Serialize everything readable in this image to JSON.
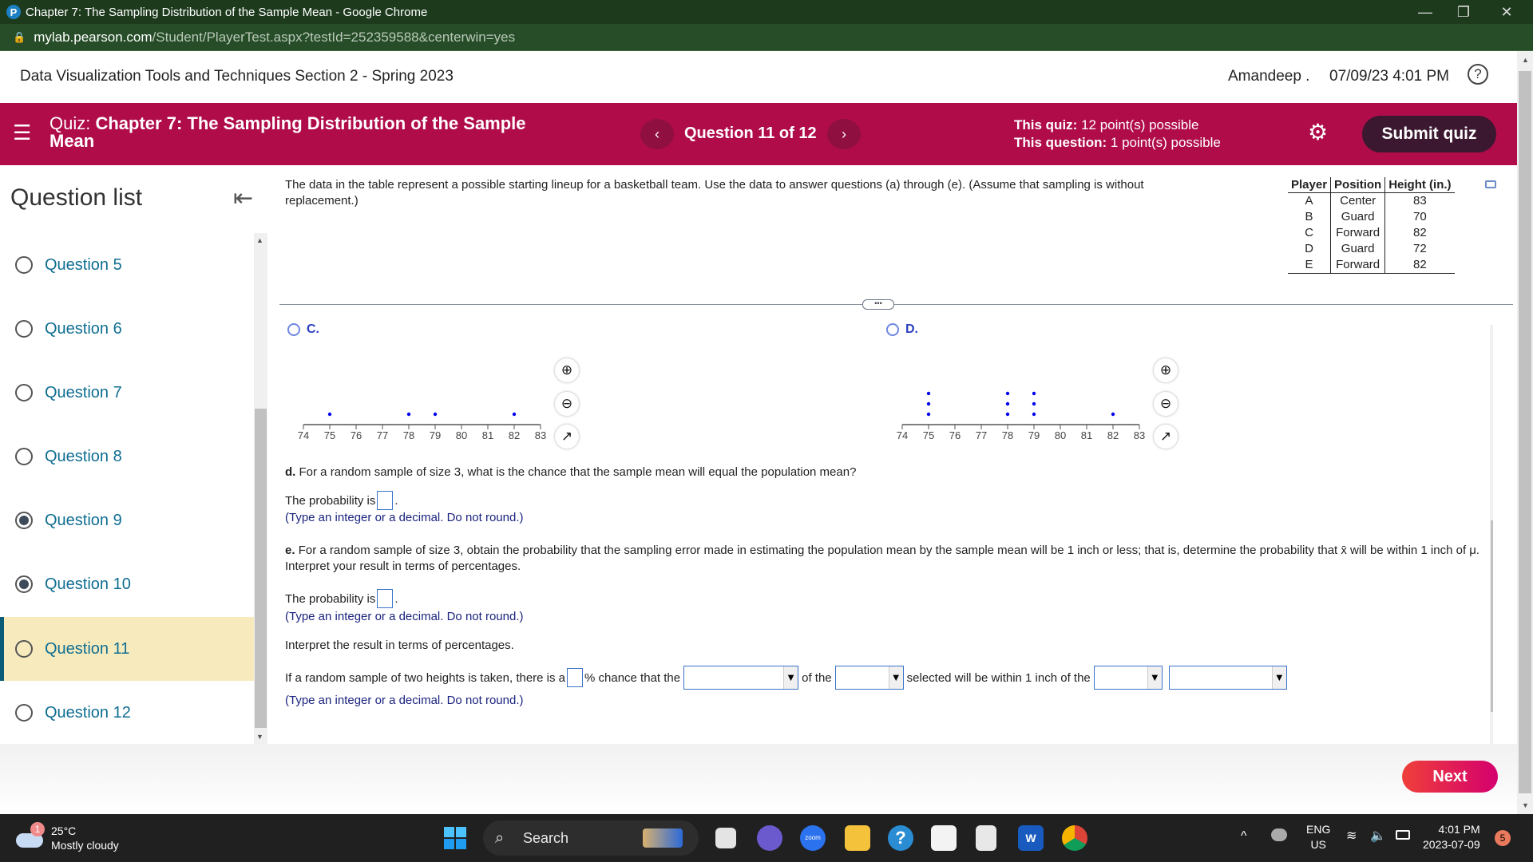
{
  "browser": {
    "window_title": "Chapter 7: The Sampling Distribution of the Sample Mean - Google Chrome",
    "url_host": "mylab.pearson.com",
    "url_path": "/Student/PlayerTest.aspx?testId=252359588&centerwin=yes",
    "controls": {
      "minimize": "—",
      "restore": "❐",
      "close": "✕"
    }
  },
  "header": {
    "course": "Data Visualization Tools and Techniques Section 2 - Spring 2023",
    "user": "Amandeep .",
    "datetime": "07/09/23 4:01 PM",
    "help_icon": "?"
  },
  "quizbar": {
    "menu_icon": "☰",
    "quiz_prefix": "Quiz:",
    "quiz_title": "Chapter 7: The Sampling Distribution of the Sample Mean",
    "prev_icon": "‹",
    "question_counter": "Question 11 of 12",
    "next_icon": "›",
    "this_quiz_label": "This quiz:",
    "this_quiz_value": "12 point(s) possible",
    "this_question_label": "This question:",
    "this_question_value": "1 point(s) possible",
    "settings_icon": "⚙",
    "submit_label": "Submit quiz",
    "accent_color": "#b00c4a"
  },
  "sidebar": {
    "title": "Question list",
    "collapse_icon": "⇤",
    "items": [
      {
        "label": "Question 5",
        "state": "unanswered"
      },
      {
        "label": "Question 6",
        "state": "unanswered"
      },
      {
        "label": "Question 7",
        "state": "unanswered"
      },
      {
        "label": "Question 8",
        "state": "unanswered"
      },
      {
        "label": "Question 9",
        "state": "answered"
      },
      {
        "label": "Question 10",
        "state": "answered"
      },
      {
        "label": "Question 11",
        "state": "current"
      },
      {
        "label": "Question 12",
        "state": "unanswered"
      }
    ]
  },
  "question": {
    "intro": "The data in the table represent a possible starting lineup for a basketball team. Use the data to answer questions (a) through (e). (Assume that sampling is without replacement.)",
    "table": {
      "headers": [
        "Player",
        "Position",
        "Height (in.)"
      ],
      "rows": [
        [
          "A",
          "Center",
          "83"
        ],
        [
          "B",
          "Guard",
          "70"
        ],
        [
          "C",
          "Forward",
          "82"
        ],
        [
          "D",
          "Guard",
          "72"
        ],
        [
          "E",
          "Forward",
          "82"
        ]
      ]
    },
    "divider_handle": "•••",
    "options": [
      {
        "label": "C.",
        "axis_ticks": [
          74,
          75,
          76,
          77,
          78,
          79,
          80,
          81,
          82,
          83
        ],
        "dots": [
          {
            "x": 75,
            "count": 1
          },
          {
            "x": 78,
            "count": 1
          },
          {
            "x": 79,
            "count": 1
          },
          {
            "x": 82,
            "count": 1
          }
        ]
      },
      {
        "label": "D.",
        "axis_ticks": [
          74,
          75,
          76,
          77,
          78,
          79,
          80,
          81,
          82,
          83
        ],
        "dots": [
          {
            "x": 75,
            "count": 3
          },
          {
            "x": 78,
            "count": 3
          },
          {
            "x": 79,
            "count": 3
          },
          {
            "x": 82,
            "count": 1
          }
        ]
      }
    ],
    "tool_icons": {
      "zoom_in": "⊕",
      "zoom_out": "⊖",
      "popout": "↗"
    },
    "part_d": {
      "label": "d.",
      "text": "For a random sample of size 3, what is the chance that the sample mean will equal the population mean?",
      "answer_prefix": "The probability is",
      "answer_value": "",
      "answer_suffix": ".",
      "hint": "(Type an integer or a decimal. Do not round.)"
    },
    "part_e": {
      "label": "e.",
      "text": "For a random sample of size 3, obtain the probability that the sampling error made in estimating the population mean by the sample mean will be 1 inch or less; that is, determine the probability that x̄ will be within 1 inch of μ. Interpret your result in terms of percentages.",
      "answer_prefix": "The probability is",
      "answer_value": "",
      "answer_suffix": ".",
      "hint": "(Type an integer or a decimal. Do not round.)",
      "interpret_label": "Interpret the result in terms of percentages.",
      "sentence": {
        "s1": "If a random sample of two heights is taken, there is a",
        "pct_value": "",
        "s2": "% chance that the",
        "dd1": "",
        "s3": "of the",
        "dd2": "",
        "s4": "selected will be within 1 inch of the",
        "dd3": "",
        "dd4": ""
      },
      "hint2": "(Type an integer or a decimal. Do not round.)"
    }
  },
  "footer": {
    "next_label": "Next"
  },
  "taskbar": {
    "weather_badge": "1",
    "temperature": "25°C",
    "weather": "Mostly cloudy",
    "search_label": "Search",
    "lang_top": "ENG",
    "lang_bottom": "US",
    "time": "4:01 PM",
    "date": "2023-07-09",
    "notification_count": "5"
  }
}
